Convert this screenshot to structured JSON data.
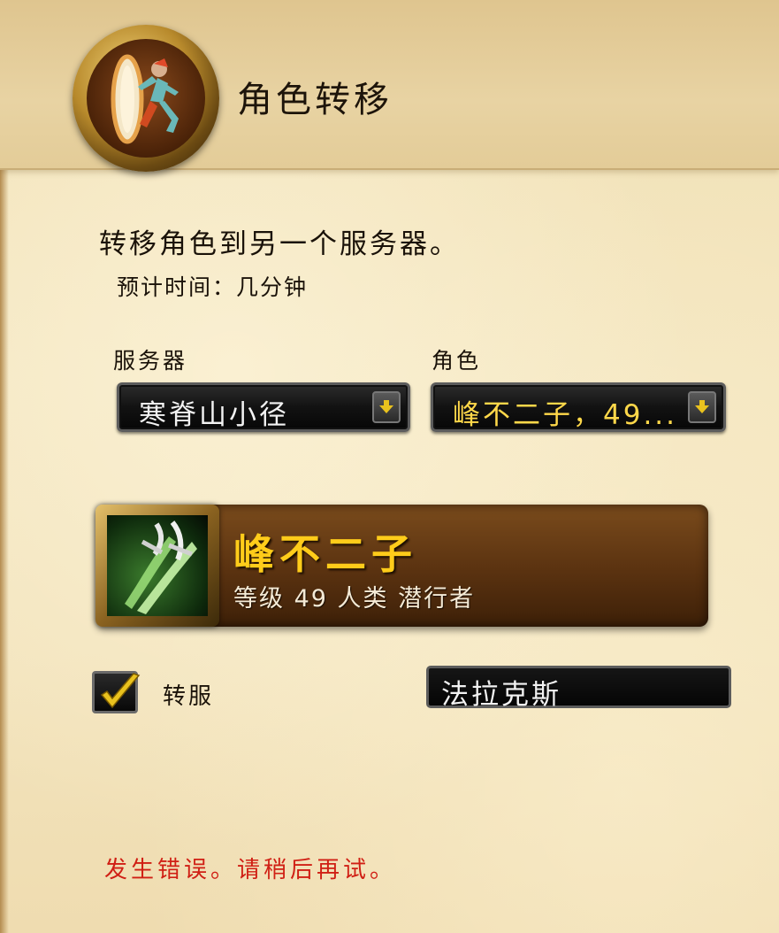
{
  "header": {
    "title": "角色转移",
    "icon": "running-man-portal-icon"
  },
  "info": {
    "description": "转移角色到另一个服务器。",
    "time_estimate": "预计时间：几分钟"
  },
  "server_select": {
    "label": "服务器",
    "value": "寒脊山小径"
  },
  "character_select": {
    "label": "角色",
    "value": "峰不二子，49..."
  },
  "character_card": {
    "name": "峰不二子",
    "details": "等级 49 人类 潜行者",
    "class_icon": "rogue-daggers-icon"
  },
  "transfer": {
    "checkbox_label": "转服",
    "checked": true,
    "target_realm": "法拉克斯"
  },
  "error": {
    "message": "发生错误。请稍后再试。"
  },
  "colors": {
    "character_name": "#ffcc1a",
    "selected_character": "#ffd84a",
    "error": "#d01f14",
    "checkmark": "#e9c21e"
  }
}
